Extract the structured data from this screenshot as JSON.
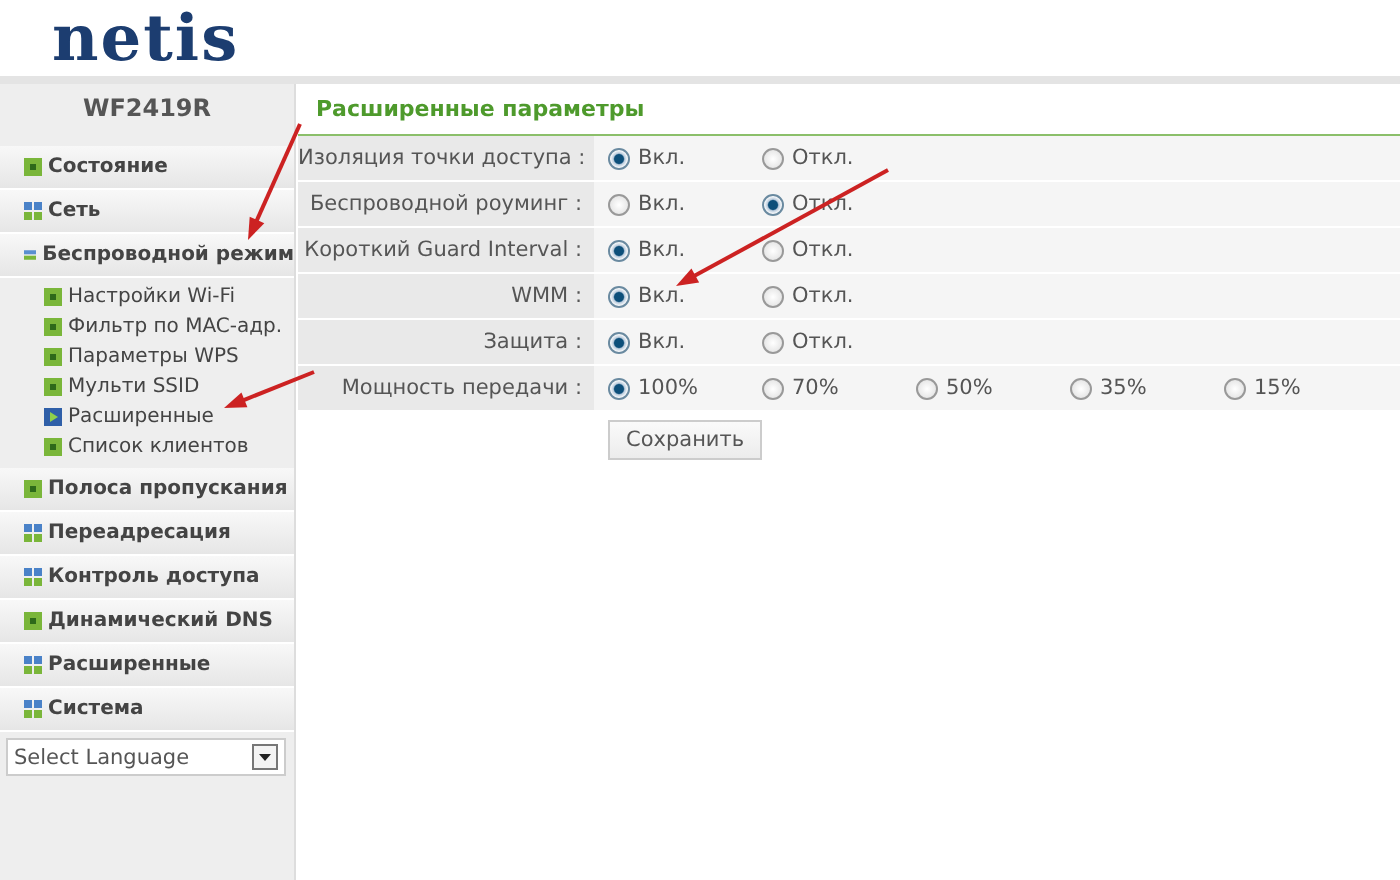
{
  "logo": "netis",
  "model": "WF2419R",
  "menu": [
    {
      "label": "Состояние",
      "kind": "square"
    },
    {
      "label": "Сеть",
      "kind": "grid"
    },
    {
      "label": "Беспроводной режим",
      "kind": "bars",
      "children": [
        {
          "label": "Настройки Wi-Fi",
          "selected": false
        },
        {
          "label": "Фильтр по MAC-адр.",
          "selected": false
        },
        {
          "label": "Параметры WPS",
          "selected": false
        },
        {
          "label": "Мульти SSID",
          "selected": false
        },
        {
          "label": "Расширенные",
          "selected": true
        },
        {
          "label": "Список клиентов",
          "selected": false
        }
      ]
    },
    {
      "label": "Полоса пропускания",
      "kind": "square"
    },
    {
      "label": "Переадресация",
      "kind": "grid"
    },
    {
      "label": "Контроль доступа",
      "kind": "grid"
    },
    {
      "label": "Динамический DNS",
      "kind": "square"
    },
    {
      "label": "Расширенные",
      "kind": "grid"
    },
    {
      "label": "Система",
      "kind": "grid"
    }
  ],
  "language": {
    "value": "Select Language"
  },
  "panel": {
    "title": "Расширенные параметры",
    "rows": [
      {
        "label": "Изоляция точки доступа :",
        "options": [
          {
            "label": "Вкл.",
            "selected": true
          },
          {
            "label": "Откл.",
            "selected": false
          }
        ]
      },
      {
        "label": "Беспроводной роуминг :",
        "options": [
          {
            "label": "Вкл.",
            "selected": false
          },
          {
            "label": "Откл.",
            "selected": true
          }
        ]
      },
      {
        "label": "Короткий Guard Interval :",
        "options": [
          {
            "label": "Вкл.",
            "selected": true
          },
          {
            "label": "Откл.",
            "selected": false
          }
        ]
      },
      {
        "label": "WMM :",
        "options": [
          {
            "label": "Вкл.",
            "selected": true
          },
          {
            "label": "Откл.",
            "selected": false
          }
        ]
      },
      {
        "label": "Защита :",
        "options": [
          {
            "label": "Вкл.",
            "selected": true
          },
          {
            "label": "Откл.",
            "selected": false
          }
        ]
      },
      {
        "label": "Мощность передачи :",
        "options": [
          {
            "label": "100%",
            "selected": true
          },
          {
            "label": "70%",
            "selected": false
          },
          {
            "label": "50%",
            "selected": false
          },
          {
            "label": "35%",
            "selected": false
          },
          {
            "label": "15%",
            "selected": false
          }
        ]
      }
    ],
    "save_button": "Сохранить"
  }
}
